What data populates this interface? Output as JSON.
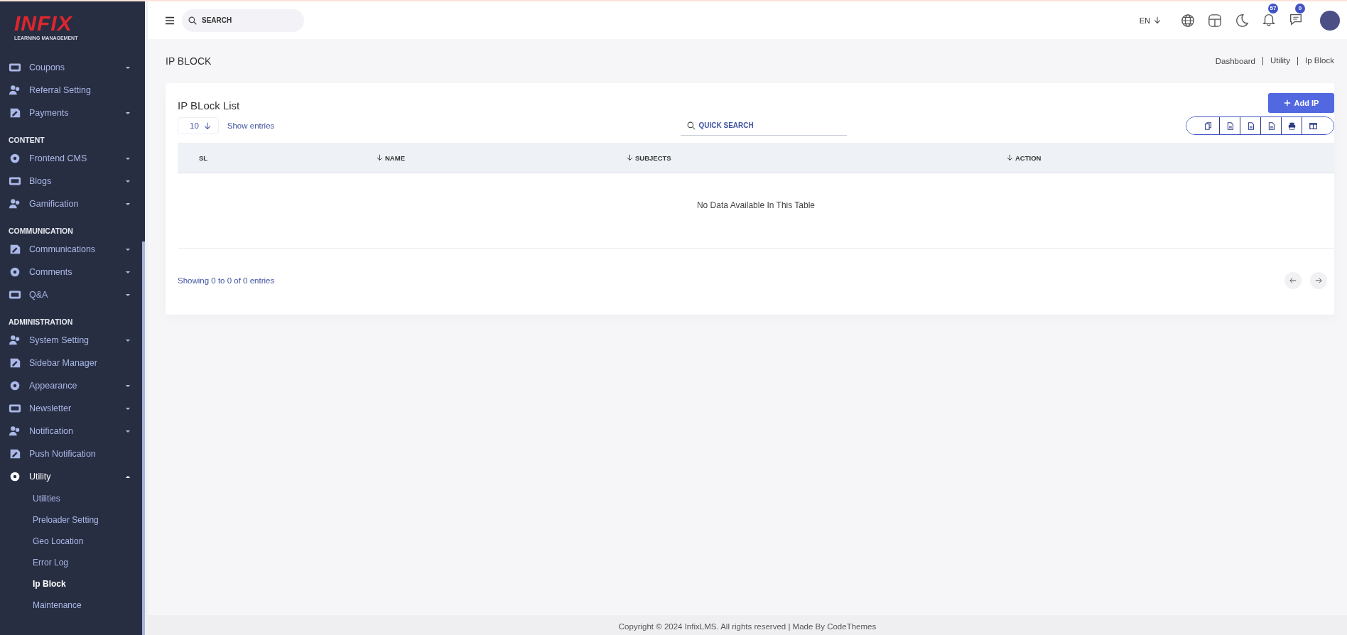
{
  "logo": {
    "brand": "INFIX",
    "tagline": "LEARNING MANAGEMENT"
  },
  "sidebar": {
    "sections": [
      {
        "items": [
          {
            "label": "Coupons",
            "kind": "menu",
            "expanded": false,
            "selected": false
          },
          {
            "label": "Referral Setting",
            "kind": "link",
            "selected": false
          },
          {
            "label": "Payments",
            "kind": "menu",
            "expanded": false,
            "selected": false
          }
        ]
      },
      {
        "heading": "CONTENT",
        "items": [
          {
            "label": "Frontend CMS",
            "kind": "menu",
            "expanded": false,
            "selected": false
          },
          {
            "label": "Blogs",
            "kind": "menu",
            "expanded": false,
            "selected": false
          },
          {
            "label": "Gamification",
            "kind": "menu",
            "expanded": false,
            "selected": false
          }
        ]
      },
      {
        "heading": "COMMUNICATION",
        "items": [
          {
            "label": "Communications",
            "kind": "menu",
            "expanded": false,
            "selected": false
          },
          {
            "label": "Comments",
            "kind": "menu",
            "expanded": false,
            "selected": false
          },
          {
            "label": "Q&A",
            "kind": "menu",
            "expanded": false,
            "selected": false
          }
        ]
      },
      {
        "heading": "ADMINISTRATION",
        "items": [
          {
            "label": "System Setting",
            "kind": "menu",
            "expanded": false,
            "selected": false
          },
          {
            "label": "Sidebar Manager",
            "kind": "link",
            "selected": false
          },
          {
            "label": "Appearance",
            "kind": "menu",
            "expanded": false,
            "selected": false
          },
          {
            "label": "Newsletter",
            "kind": "menu",
            "expanded": false,
            "selected": false
          },
          {
            "label": "Notification",
            "kind": "menu",
            "expanded": false,
            "selected": false
          },
          {
            "label": "Push Notification",
            "kind": "link",
            "selected": false
          },
          {
            "label": "Utility",
            "kind": "menu",
            "expanded": true,
            "selected": true,
            "children": [
              {
                "label": "Utilities",
                "selected": false
              },
              {
                "label": "Preloader Setting",
                "selected": false
              },
              {
                "label": "Geo Location",
                "selected": false
              },
              {
                "label": "Error Log",
                "selected": false
              },
              {
                "label": "Ip Block",
                "selected": true
              },
              {
                "label": "Maintenance",
                "selected": false
              }
            ]
          }
        ]
      }
    ]
  },
  "header": {
    "search": {
      "placeholder": "SEARCH"
    },
    "language": "EN",
    "notifications_count": "57",
    "messages_count": "0"
  },
  "page": {
    "title": "IP BLOCK",
    "breadcrumbs": [
      "Dashboard",
      "Utility",
      "Ip Block"
    ]
  },
  "card": {
    "title": "IP BLock List",
    "add_button": "Add IP",
    "page_size": "10",
    "show_entries": "Show entries",
    "quick_search": {
      "placeholder": "QUICK SEARCH"
    },
    "columns": [
      {
        "label": "SL",
        "sortable": false
      },
      {
        "label": "NAME",
        "sortable": true
      },
      {
        "label": "SUBJECTS",
        "sortable": true
      },
      {
        "label": "ACTION",
        "sortable": true
      }
    ],
    "empty_message": "No Data Available In This Table",
    "summary": "Showing 0 to 0 of 0 entries"
  },
  "footer": {
    "text": "Copyright © 2024 InfixLMS. All rights reserved | Made By CodeThemes"
  }
}
